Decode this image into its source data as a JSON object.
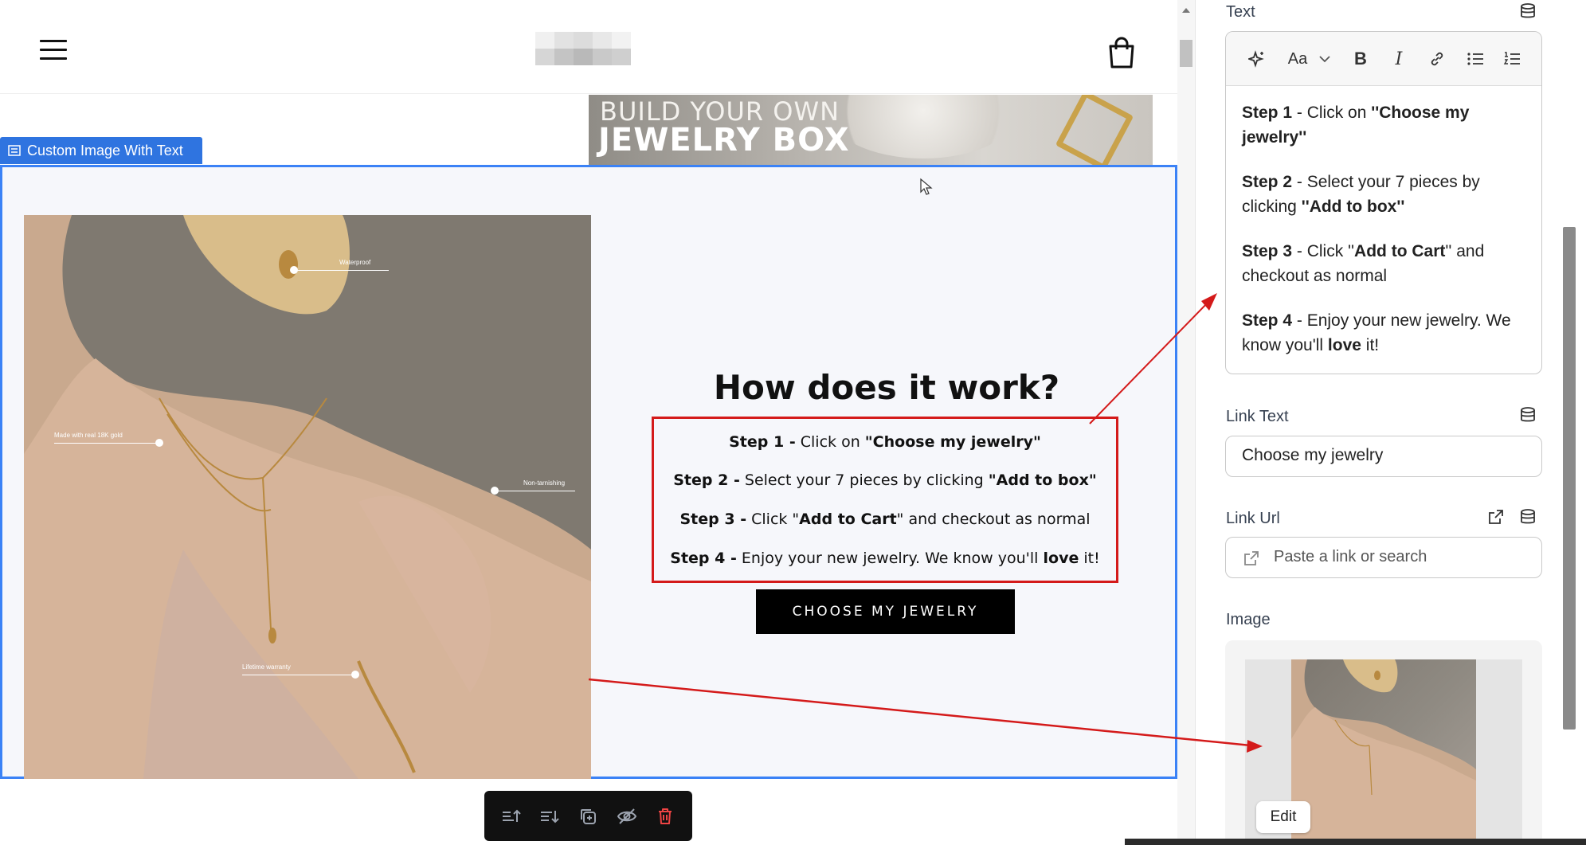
{
  "banner": {
    "line1": "BUILD YOUR OWN",
    "line2": "JEWELRY BOX"
  },
  "section_tag": {
    "label": "Custom Image With Text"
  },
  "photo": {
    "annotations": [
      "Waterproof",
      "Made with real 18K gold",
      "Non-tarnishing",
      "Lifetime warranty"
    ]
  },
  "content": {
    "title": "How does it work?",
    "steps": [
      {
        "lead": "Step 1 -",
        "parts": [
          " Click on ",
          "\"Choose my jewelry\"",
          ""
        ]
      },
      {
        "lead": "Step 2 -",
        "parts": [
          " Select your 7 pieces by clicking ",
          "\"Add to box\"",
          ""
        ]
      },
      {
        "lead": "Step 3 -",
        "parts": [
          " Click \"",
          "Add to Cart",
          "\" and checkout as normal"
        ]
      },
      {
        "lead": "Step 4 -",
        "parts": [
          " Enjoy your new jewelry. We know you'll ",
          "love",
          " it!"
        ]
      }
    ],
    "cta_label": "CHOOSE MY JEWELRY"
  },
  "sidebar": {
    "text_label": "Text",
    "editor": {
      "font_label": "Aa",
      "paragraphs": [
        {
          "lead": "Step 1",
          "parts": [
            " - Click on ",
            "''Choose my jewelry''",
            ""
          ]
        },
        {
          "lead": "Step 2",
          "parts": [
            " - Select your 7 pieces by clicking ",
            "''Add to box''",
            ""
          ]
        },
        {
          "lead": "Step 3",
          "parts": [
            " - Click ''",
            "Add to Cart",
            "'' and checkout as normal"
          ]
        },
        {
          "lead": "Step 4",
          "parts": [
            " -  Enjoy your new jewelry. We know you'll ",
            "love",
            " it!"
          ]
        }
      ]
    },
    "link_text_label": "Link Text",
    "link_text_value": "Choose my jewelry",
    "link_url_label": "Link Url",
    "link_url_placeholder": "Paste a link or search",
    "image_label": "Image",
    "edit_label": "Edit"
  },
  "colors": {
    "accent_blue": "#2f74e0",
    "highlight_red": "#d41a1a",
    "delete_red": "#ef4444"
  }
}
